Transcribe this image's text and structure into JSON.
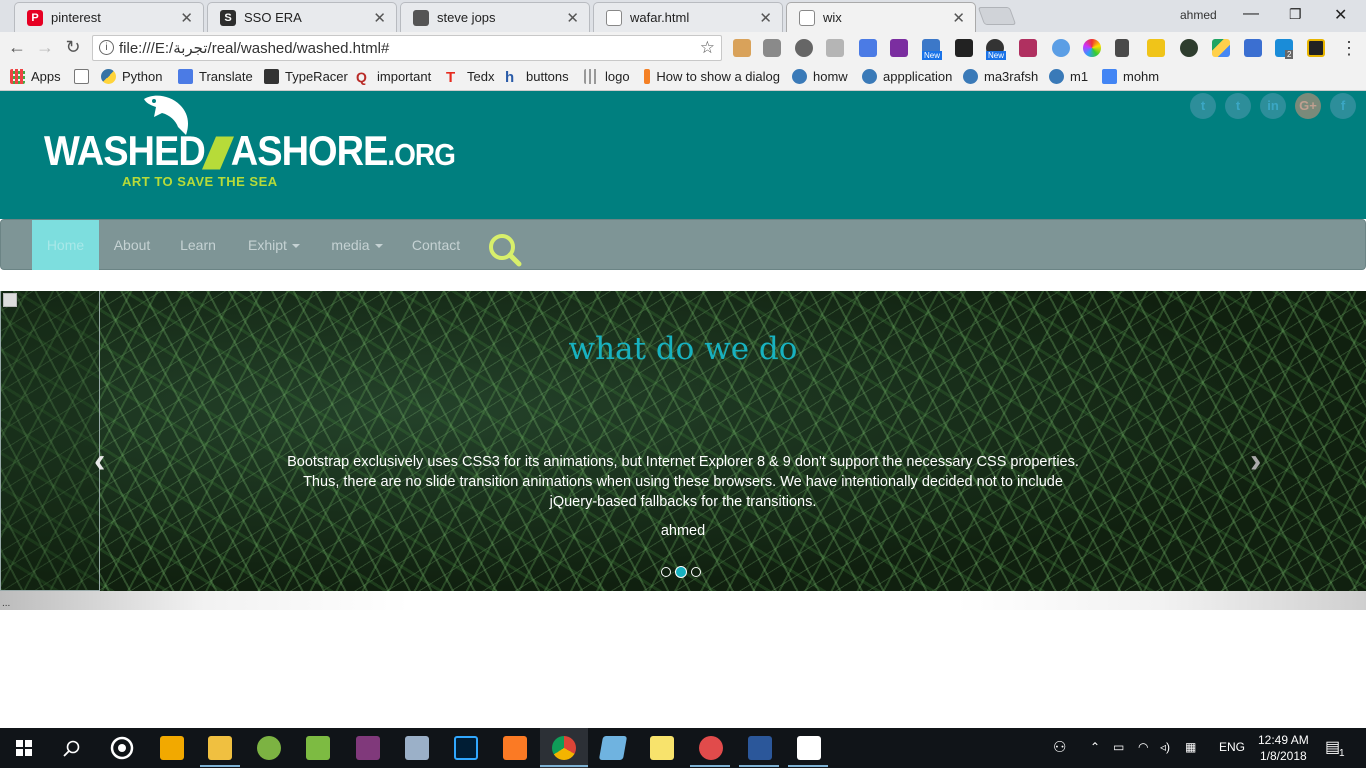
{
  "browser": {
    "tabs": [
      {
        "title": "pinterest",
        "icon": "pinterest-icon"
      },
      {
        "title": "SSO ERA",
        "icon": "sso-icon"
      },
      {
        "title": "steve jops",
        "icon": "page-thumb-icon"
      },
      {
        "title": "wafar.html",
        "icon": "file-icon"
      },
      {
        "title": "wix",
        "icon": "file-icon"
      }
    ],
    "profile_name": "ahmed",
    "url": "file:///E:/تجربة/real/washed/washed.html#",
    "bookmarks": [
      "Apps",
      "",
      "Python",
      "Translate",
      "TypeRacer",
      "important",
      "Tedx",
      "buttons",
      "logo",
      "How to show a dialog",
      "homw",
      "appplication",
      "ma3rafsh",
      "m1",
      "mohm"
    ],
    "extension_badges": {
      "new1": "New",
      "new2": "New",
      "s_count": "2"
    }
  },
  "site": {
    "logo_main": "WASHED",
    "logo_main2": "ASHORE",
    "logo_org": ".ORG",
    "logo_tagline": "ART TO SAVE THE SEA",
    "social": [
      "t",
      "t",
      "in",
      "G+",
      "f"
    ],
    "nav": [
      {
        "label": "Home",
        "active": true
      },
      {
        "label": "About"
      },
      {
        "label": "Learn"
      },
      {
        "label": "Exhipt",
        "dropdown": true
      },
      {
        "label": "media",
        "dropdown": true
      },
      {
        "label": "Contact"
      }
    ],
    "carousel": {
      "title": "what do we do",
      "text": "Bootstrap exclusively uses CSS3 for its animations, but Internet Explorer 8 & 9 don't support the necessary CSS properties. Thus, there are no slide transition animations when using these browsers. We have intentionally decided not to include jQuery-based fallbacks for the transitions.",
      "author": "ahmed",
      "prev": "‹",
      "next": "›",
      "slide_count": 3,
      "active_slide": 2
    },
    "loading_dots": "..."
  },
  "taskbar": {
    "language": "ENG",
    "time": "12:49 AM",
    "date": "1/8/2018",
    "notification_count": "1"
  }
}
